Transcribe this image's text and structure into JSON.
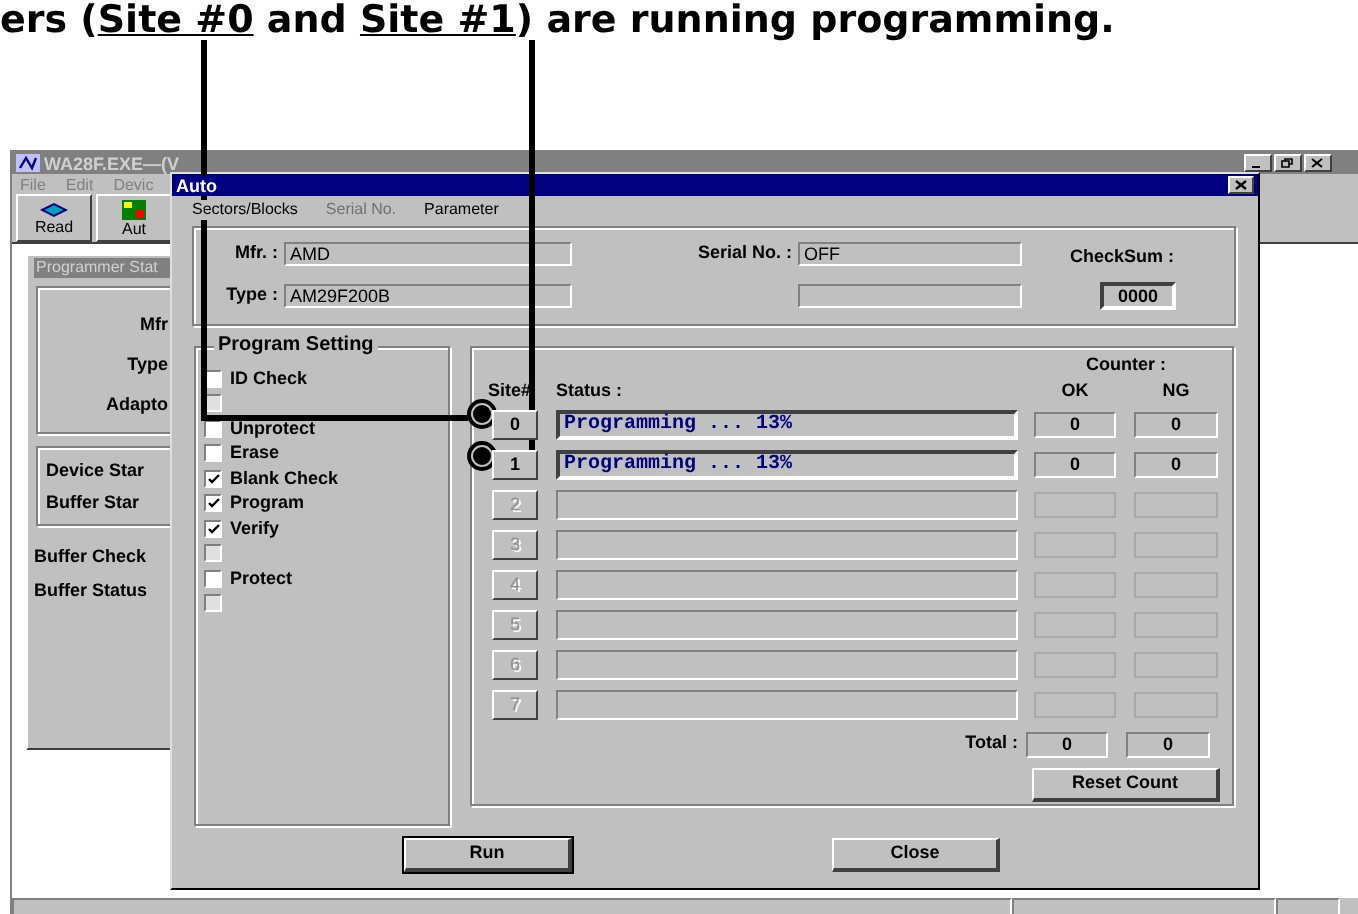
{
  "caption": [
    {
      "text": "ers (",
      "underlined": false
    },
    {
      "text": "Site #0",
      "underlined": true
    },
    {
      "text": " and ",
      "underlined": false
    },
    {
      "text": "Site #1",
      "underlined": true
    },
    {
      "text": ") are running programming.",
      "underlined": false
    }
  ],
  "main_window": {
    "title": "WA28F.EXE—(V",
    "menu": [
      "File",
      "Edit",
      "Devic"
    ],
    "toolbar": [
      "Read",
      "Aut"
    ],
    "status_panel": {
      "title": "Programmer Stat",
      "device_labels": [
        "Mfr",
        "Type",
        "Adapto"
      ],
      "state_labels": [
        "Device Star",
        "Buffer Star"
      ],
      "buffer_labels": [
        "Buffer Check",
        "Buffer Status"
      ]
    }
  },
  "dialog": {
    "title": "Auto",
    "menu": [
      {
        "label": "Sectors/Blocks",
        "disabled": false
      },
      {
        "label": "Serial No.",
        "disabled": true
      },
      {
        "label": "Parameter",
        "disabled": false
      }
    ],
    "mfr": {
      "label": "Mfr. :",
      "value": "AMD"
    },
    "type": {
      "label": "Type :",
      "value": "AM29F200B"
    },
    "serial": {
      "label": "Serial No. :",
      "value": "OFF"
    },
    "checksum": {
      "label": "CheckSum :",
      "value": "0000"
    },
    "program_setting": {
      "title": "Program Setting",
      "options": [
        {
          "label": "ID Check",
          "checked": false,
          "disabled": false
        },
        {
          "checked": false,
          "disabled": true
        },
        {
          "label": "Unprotect",
          "checked": false,
          "disabled": false
        },
        {
          "label": "Erase",
          "checked": false,
          "disabled": false
        },
        {
          "label": "Blank Check",
          "checked": true,
          "disabled": false
        },
        {
          "label": "Program",
          "checked": true,
          "disabled": false
        },
        {
          "label": "Verify",
          "checked": true,
          "disabled": false
        },
        {
          "checked": false,
          "disabled": true
        },
        {
          "label": "Protect",
          "checked": false,
          "disabled": false
        },
        {
          "checked": false,
          "disabled": true
        }
      ]
    },
    "sites_panel": {
      "site_header": "Site#",
      "status_header": "Status :",
      "counter_header": "Counter :",
      "ok_header": "OK",
      "ng_header": "NG",
      "sites": [
        {
          "site": "0",
          "enabled": true,
          "status": "Programming ... 13%",
          "ok": "0",
          "ng": "0"
        },
        {
          "site": "1",
          "enabled": true,
          "status": "Programming ... 13%",
          "ok": "0",
          "ng": "0"
        },
        {
          "site": "2",
          "enabled": false
        },
        {
          "site": "3",
          "enabled": false
        },
        {
          "site": "4",
          "enabled": false
        },
        {
          "site": "5",
          "enabled": false
        },
        {
          "site": "6",
          "enabled": false
        },
        {
          "site": "7",
          "enabled": false
        }
      ],
      "total_label": "Total :",
      "total_ok": "0",
      "total_ng": "0",
      "reset_button": "Reset Count"
    },
    "buttons": [
      "Run",
      "Close"
    ]
  }
}
